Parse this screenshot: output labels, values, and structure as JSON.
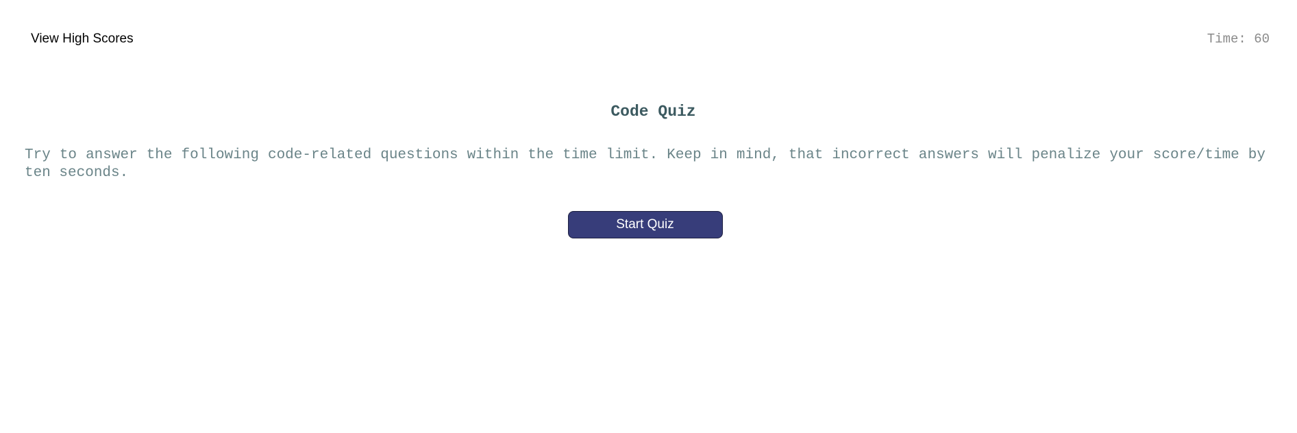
{
  "header": {
    "high_scores_label": "View High Scores",
    "timer_text": "Time: 60"
  },
  "main": {
    "title": "Code Quiz",
    "instructions": "Try to answer the following code-related questions within the time limit. Keep in mind, that incorrect answers will penalize your score/time by ten seconds.",
    "start_button_label": "Start Quiz"
  },
  "colors": {
    "button_background": "#373d7a",
    "title_color": "#3c5a60",
    "instructions_color": "#6a8488",
    "timer_color": "#8a8a8a"
  }
}
